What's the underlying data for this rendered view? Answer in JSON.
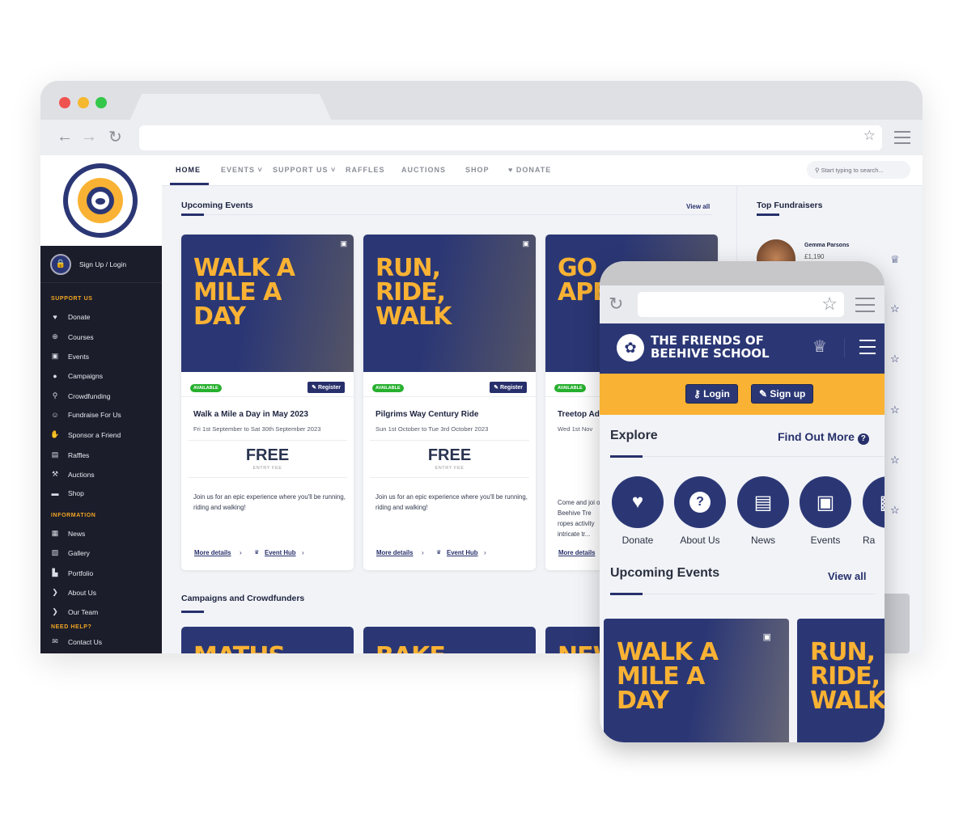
{
  "browser": {
    "controls": [
      "close",
      "minimize",
      "maximize"
    ],
    "colors": {
      "close": "#ef5350",
      "minimize": "#f5b82e",
      "maximize": "#34c749"
    }
  },
  "logo": {
    "text": "THE FRIENDS OF BEEHIVE SCHOOL"
  },
  "sidebar": {
    "login": "Sign Up / Login",
    "sections": [
      {
        "title": "SUPPORT US",
        "items": [
          {
            "label": "Donate",
            "icon": "heart-icon"
          },
          {
            "label": "Courses",
            "icon": "courses-icon"
          },
          {
            "label": "Events",
            "icon": "calendar-icon"
          },
          {
            "label": "Campaigns",
            "icon": "balloon-icon"
          },
          {
            "label": "Crowdfunding",
            "icon": "crowdfunding-icon"
          },
          {
            "label": "Fundraise For Us",
            "icon": "fundraise-icon"
          },
          {
            "label": "Sponsor a Friend",
            "icon": "handshake-icon"
          },
          {
            "label": "Raffles",
            "icon": "ticket-icon"
          },
          {
            "label": "Auctions",
            "icon": "gavel-icon"
          },
          {
            "label": "Shop",
            "icon": "shop-icon"
          }
        ]
      },
      {
        "title": "INFORMATION",
        "items": [
          {
            "label": "News",
            "icon": "news-icon"
          },
          {
            "label": "Gallery",
            "icon": "gallery-icon"
          },
          {
            "label": "Portfolio",
            "icon": "portfolio-icon"
          },
          {
            "label": "About Us",
            "icon": "chevron-circle-icon"
          },
          {
            "label": "Our Team",
            "icon": "chevron-circle-icon"
          }
        ]
      },
      {
        "title": "NEED HELP?",
        "items": [
          {
            "label": "Contact Us",
            "icon": "mail-icon"
          }
        ]
      }
    ]
  },
  "nav": {
    "items": [
      "HOME",
      "EVENTS",
      "SUPPORT US",
      "RAFFLES",
      "AUCTIONS",
      "SHOP",
      "DONATE"
    ],
    "active": "HOME",
    "search_placeholder": "Start typing to search..."
  },
  "upcoming": {
    "title": "Upcoming Events",
    "view_all": "View all",
    "cards": [
      {
        "image_text": "WALK A MILE A DAY",
        "badge": "AVAILABLE",
        "register": "Register",
        "title": "Walk a Mile a Day in May 2023",
        "date": "Fri 1st September to Sat 30th September 2023",
        "price": "FREE",
        "price_label": "ENTRY FEE",
        "desc": "Join us for an epic experience where you'll be running, riding and walking!",
        "more": "More details",
        "hub": "Event Hub"
      },
      {
        "image_text": "RUN, RIDE, WALK",
        "badge": "AVAILABLE",
        "register": "Register",
        "title": "Pilgrims Way Century Ride",
        "date": "Sun 1st October to Tue 3rd October 2023",
        "price": "FREE",
        "price_label": "ENTRY FEE",
        "desc": "Join us for an epic experience where you'll be running, riding and walking!",
        "more": "More details",
        "hub": "Event Hub"
      },
      {
        "image_text": "GO APE",
        "badge": "AVAILABLE",
        "title": "Treetop Ad",
        "date": "Wed 1st Nov",
        "desc": "Come and joi of Beehive Tre ropes activity intricate tr...",
        "more": "More details"
      }
    ]
  },
  "campaigns": {
    "title": "Campaigns and Crowdfunders",
    "cards": [
      "MATHS",
      "BAKE",
      "NEW"
    ]
  },
  "fundraisers": {
    "title": "Top Fundraisers",
    "top": {
      "name": "Gemma Parsons",
      "amount": "£1,190"
    }
  },
  "mobile": {
    "brand_line1": "THE FRIENDS OF",
    "brand_line2": "BEEHIVE SCHOOL",
    "login": "Login",
    "signup": "Sign up",
    "explore": "Explore",
    "find_out_more": "Find Out More",
    "tiles": [
      {
        "label": "Donate",
        "icon": "heart-icon"
      },
      {
        "label": "About Us",
        "icon": "question-icon"
      },
      {
        "label": "News",
        "icon": "news-icon"
      },
      {
        "label": "Events",
        "icon": "calendar-icon"
      },
      {
        "label": "Ra",
        "icon": "raffle-icon"
      }
    ],
    "upcoming": "Upcoming Events",
    "view_all": "View all",
    "cards": [
      "WALK A MILE A DAY",
      "RUN, RIDE, WALK"
    ]
  },
  "colors": {
    "navy": "#2b3775",
    "yellow": "#f9b233",
    "sidebar": "#1b1d2b",
    "available": "#27b02f"
  }
}
